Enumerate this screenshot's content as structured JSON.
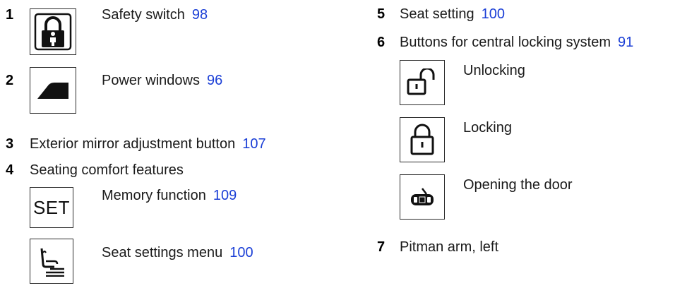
{
  "items": [
    {
      "number": "1",
      "label": "Safety switch",
      "ref": "98"
    },
    {
      "number": "2",
      "label": "Power windows",
      "ref": "96"
    },
    {
      "number": "3",
      "label": "Exterior mirror adjustment button",
      "ref": "107"
    },
    {
      "number": "4",
      "label": "Seating comfort features",
      "subitems": [
        {
          "label": "Memory function",
          "ref": "109",
          "icon_text": "SET"
        },
        {
          "label": "Seat settings menu",
          "ref": "100"
        }
      ]
    },
    {
      "number": "5",
      "label": "Seat setting",
      "ref": "100"
    },
    {
      "number": "6",
      "label": "Buttons for central locking system",
      "ref": "91",
      "subitems": [
        {
          "label": "Unlocking"
        },
        {
          "label": "Locking"
        },
        {
          "label": "Opening the door"
        }
      ]
    },
    {
      "number": "7",
      "label": "Pitman arm, left"
    }
  ],
  "colors": {
    "link": "#1a3ed6",
    "text": "#1a1a1a",
    "border": "#2b2b2b"
  },
  "icons": [
    "child-lock-icon",
    "power-window-icon",
    "set-memory-icon",
    "seat-settings-icon",
    "unlock-icon",
    "lock-icon",
    "door-open-icon"
  ]
}
